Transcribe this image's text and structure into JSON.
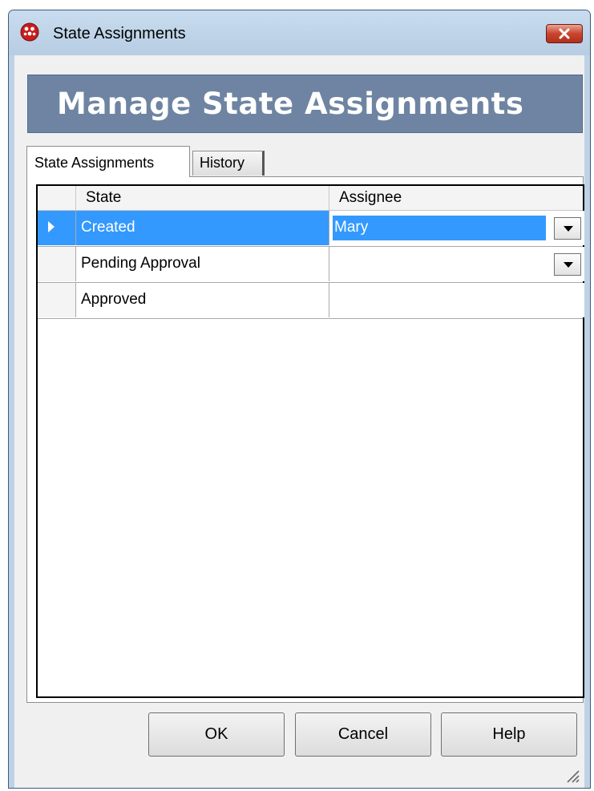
{
  "window": {
    "title": "State Assignments",
    "icon": "red-cluster-app-icon",
    "close_icon": "close-icon"
  },
  "banner": {
    "title": "Manage State Assignments"
  },
  "tabs": [
    {
      "label": "State Assignments",
      "selected": true
    },
    {
      "label": "History",
      "selected": false
    }
  ],
  "grid": {
    "columns": [
      "State",
      "Assignee"
    ],
    "rows": [
      {
        "state": "Created",
        "assignee": "Mary",
        "current": true,
        "dropdown": true
      },
      {
        "state": "Pending Approval",
        "assignee": "",
        "current": false,
        "dropdown": true
      },
      {
        "state": "Approved",
        "assignee": "",
        "current": false,
        "dropdown": false
      }
    ]
  },
  "buttons": {
    "ok": "OK",
    "cancel": "Cancel",
    "help": "Help"
  },
  "colors": {
    "selection": "#3399ff",
    "banner": "#6e84a2",
    "titlebar": "#bed2e6"
  }
}
